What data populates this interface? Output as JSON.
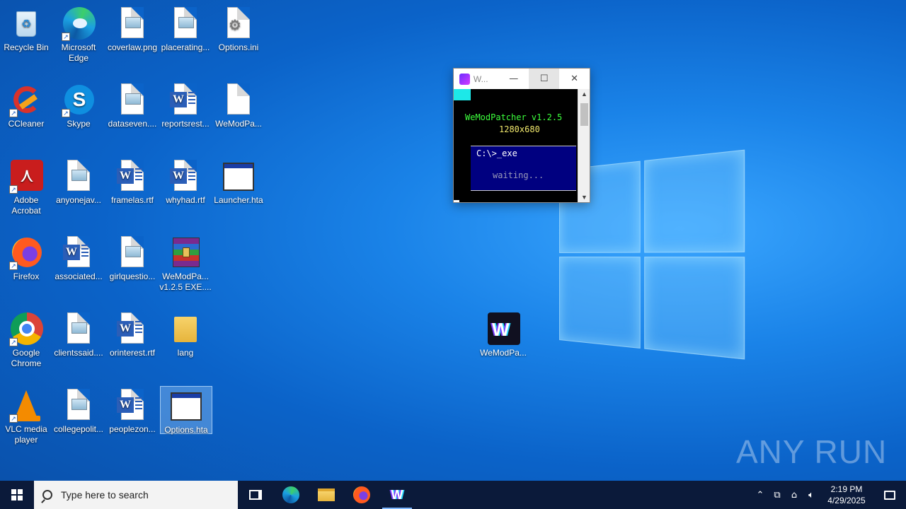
{
  "desktop": {
    "icons": [
      {
        "label": "Recycle Bin"
      },
      {
        "label": "Microsoft Edge"
      },
      {
        "label": "coverlaw.png"
      },
      {
        "label": "placerating..."
      },
      {
        "label": "Options.ini"
      },
      {
        "label": "CCleaner"
      },
      {
        "label": "Skype"
      },
      {
        "label": "dataseven...."
      },
      {
        "label": "reportsrest..."
      },
      {
        "label": "WeModPa..."
      },
      {
        "label": "Adobe Acrobat"
      },
      {
        "label": "anyonejav..."
      },
      {
        "label": "framelas.rtf"
      },
      {
        "label": "whyhad.rtf"
      },
      {
        "label": "Launcher.hta"
      },
      {
        "label": "Firefox"
      },
      {
        "label": "associated..."
      },
      {
        "label": "girlquestio..."
      },
      {
        "label": "WeModPa... v1.2.5 EXE...."
      },
      {
        "label": "Google Chrome"
      },
      {
        "label": "clientssaid...."
      },
      {
        "label": "orinterest.rtf"
      },
      {
        "label": "lang"
      },
      {
        "label": "VLC media player"
      },
      {
        "label": "collegepolit..."
      },
      {
        "label": "peoplezon..."
      },
      {
        "label": "Options.hta"
      },
      {
        "label": "WeModPa..."
      }
    ]
  },
  "console": {
    "title": "W...",
    "app_title": "WeModPatcher v1.2.5",
    "resolution": "1280x680",
    "prompt": "C:\\>_exe",
    "status": "waiting..."
  },
  "watermark": "ANY RUN",
  "taskbar": {
    "search_placeholder": "Type here to search",
    "time": "2:19 PM",
    "date": "4/29/2025"
  }
}
